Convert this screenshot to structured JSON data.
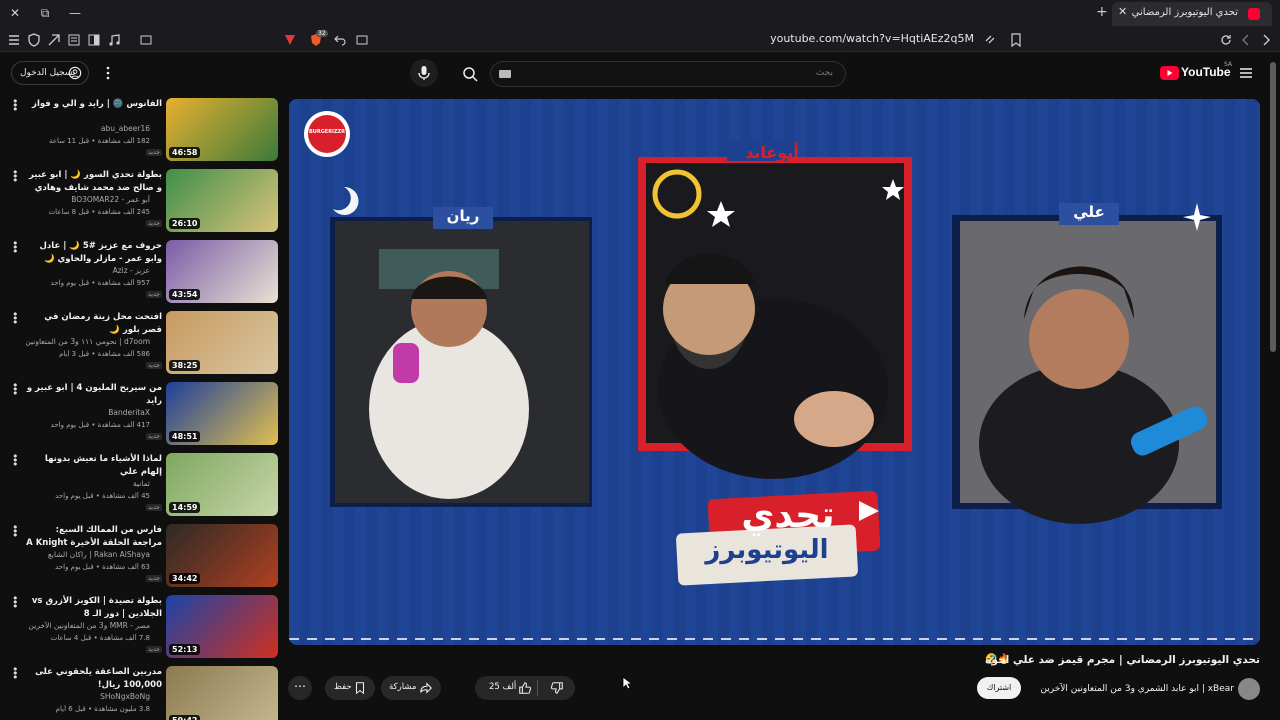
{
  "browser": {
    "tab_title": "تحدي اليوتيوبرز الرمضاني | مجرم",
    "url": "youtube.com/watch?v=HqtiAEz2q5M",
    "ad_badge": "32"
  },
  "header": {
    "logo_text": "YouTube",
    "region": "SA",
    "search_placeholder": "بحث",
    "signin_label": "تسجيل الدخول"
  },
  "player": {
    "label_left": "ريان",
    "label_center": "أبوعابد",
    "label_right": "علي",
    "logo_line1": "تحدي",
    "logo_line2": "اليوتيوبرز",
    "sponsor": "BURGERIZZR"
  },
  "video": {
    "title": "تحدي اليوتيوبرز الرمضاني | مجرم قيمز ضد علي اخوه",
    "channel_line": "xBear | ابو عابد الشمري و3 من المتعاونين الآخرين",
    "subscribe_label": "اشتراك",
    "like_label": "25 ألف",
    "share_label": "مشاركة",
    "save_label": "حفظ"
  },
  "sidebar": [
    {
      "title": "الفانوس 🌚 | رايد و الي و فواز",
      "channel": "abu_abeer16",
      "meta": "182 ألف مشاهدة • قبل 11 ساعة",
      "badge": "جديد",
      "duration": "46:58"
    },
    {
      "title": "بطولة تحدي السور 🌙 | ابو عبير و صالح ضد محمد شايف وهادي",
      "channel": "أبو عمر - BO3OMAR22",
      "meta": "245 ألف مشاهدة • قبل 8 ساعات",
      "badge": "جديد",
      "duration": "26:10"
    },
    {
      "title": "حروف مع عزيز #5 🌙 | عادل وابو عمر - مازلر والحاوي 🌙 الموسم الثالث",
      "channel": "عزيز - Aziz",
      "meta": "957 ألف مشاهدة • قبل يوم واحد",
      "badge": "جديد",
      "duration": "43:54"
    },
    {
      "title": "افتحت محل زينة رمضان في قصر بلور 🌙",
      "channel": "d7oom | نحومي ١١١ و3 من المتعاونين الآخرين",
      "meta": "586 ألف مشاهدة • قبل 3 أيام",
      "badge": "جديد",
      "duration": "38:25"
    },
    {
      "title": "من سيربح المليون 4 | ابو عبير و رايد",
      "channel": "BanderitaX",
      "meta": "417 ألف مشاهدة • قبل يوم واحد",
      "badge": "جديد",
      "duration": "48:51"
    },
    {
      "title": "لماذا الأشياء ما تعيش بدونها إلهام علي",
      "channel": "ثمانية",
      "meta": "45 ألف مشاهدة • قبل يوم واحد",
      "badge": "جديد",
      "duration": "14:59"
    },
    {
      "title": "فارس من الممالك السبع: مراجعة الحلقة الأخيرة A Knight of the Seven",
      "channel": "Rakan AlShaya | راكان الشايع",
      "meta": "63 ألف مشاهدة • قبل يوم واحد",
      "badge": "جديد",
      "duration": "34:42"
    },
    {
      "title": "بطولة تصيدة | الكوبز الأزرق vs الجلادين | دور الـ 8",
      "channel": "مصر - MMR و3 من المتعاونين الآخرين",
      "meta": "7.8 ألف مشاهدة • قبل 4 ساعات",
      "badge": "جديد",
      "duration": "52:13"
    },
    {
      "title": "مدربين الصاعقة يلحقوني على 100,000 ريال!",
      "channel": "SHoNgxBoNg",
      "meta": "3.8 مليون مشاهدة • قبل 6 أيام",
      "badge": "",
      "duration": "59:42"
    }
  ],
  "colors": {
    "brand_red": "#ff0033",
    "player_blue": "#1c3f8c",
    "frame_red": "#d8202b"
  },
  "icons": [
    "close-icon",
    "restore-icon",
    "minimize-icon",
    "menu-icon",
    "shield-icon",
    "extensions-icon",
    "reader-icon",
    "sidebar-icon",
    "music-icon",
    "screenshot-icon",
    "brave-icon",
    "back-icon",
    "cast-icon",
    "bookmark-icon",
    "reload-icon",
    "forward-icon",
    "mic-icon",
    "search-icon",
    "keyboard-icon",
    "hamburger-icon",
    "account-icon",
    "kebab-icon",
    "like-icon",
    "dislike-icon",
    "share-icon",
    "save-icon",
    "more-icon"
  ]
}
